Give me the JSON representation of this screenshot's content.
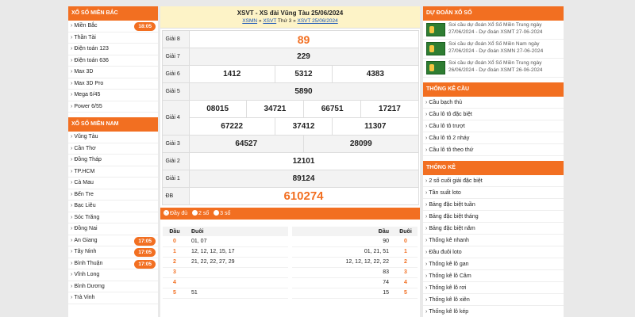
{
  "left": {
    "north_title": "XỔ SỐ MIỀN BẮC",
    "north_items": [
      {
        "label": "Miền Bắc",
        "badge": "18:05"
      },
      {
        "label": "Thần Tài",
        "badge": ""
      },
      {
        "label": "Điện toán 123",
        "badge": ""
      },
      {
        "label": "Điện toán 636",
        "badge": ""
      },
      {
        "label": "Max 3D",
        "badge": ""
      },
      {
        "label": "Max 3D Pro",
        "badge": ""
      },
      {
        "label": "Mega 6/45",
        "badge": ""
      },
      {
        "label": "Power 6/55",
        "badge": ""
      }
    ],
    "south_title": "XỔ SỐ MIỀN NAM",
    "south_items": [
      {
        "label": "Vũng Tàu",
        "badge": ""
      },
      {
        "label": "Cần Thơ",
        "badge": ""
      },
      {
        "label": "Đồng Tháp",
        "badge": ""
      },
      {
        "label": "TP.HCM",
        "badge": ""
      },
      {
        "label": "Cà Mau",
        "badge": ""
      },
      {
        "label": "Bến Tre",
        "badge": ""
      },
      {
        "label": "Bạc Liêu",
        "badge": ""
      },
      {
        "label": "Sóc Trăng",
        "badge": ""
      },
      {
        "label": "Đồng Nai",
        "badge": ""
      },
      {
        "label": "An Giang",
        "badge": "17:05"
      },
      {
        "label": "Tây Ninh",
        "badge": "17:05"
      },
      {
        "label": "Bình Thuận",
        "badge": "17:05"
      },
      {
        "label": "Vĩnh Long",
        "badge": ""
      },
      {
        "label": "Bình Dương",
        "badge": ""
      },
      {
        "label": "Trà Vinh",
        "badge": ""
      }
    ]
  },
  "result": {
    "title": "XSVT - XS đài Vũng Tàu 25/06/2024",
    "crumb1": "XSMN",
    "sep1": "»",
    "crumb2": "XSVT",
    "crumb2_suffix": "Thứ 3",
    "sep2": "»",
    "crumb3": "XSVT 25/06/2024",
    "g8_label": "Giải 8",
    "g8": "89",
    "g7_label": "Giải 7",
    "g7": "229",
    "g6_label": "Giải 6",
    "g6": [
      "1412",
      "5312",
      "4383"
    ],
    "g5_label": "Giải 5",
    "g5": "5890",
    "g4_label": "Giải 4",
    "g4a": [
      "08015",
      "34721",
      "66751",
      "17217"
    ],
    "g4b": [
      "67222",
      "37412",
      "11307"
    ],
    "g3_label": "Giải 3",
    "g3": [
      "64527",
      "28099"
    ],
    "g2_label": "Giải 2",
    "g2": "12101",
    "g1_label": "Giải 1",
    "g1": "89124",
    "db_label": "ĐB",
    "db": "610274"
  },
  "options": {
    "full": "Đầy đủ",
    "two": "2 số",
    "three": "3 số"
  },
  "loto_left": {
    "h_dau": "Đầu",
    "h_duoi": "Đuôi",
    "rows": [
      {
        "dau": "0",
        "duoi": "01, 07"
      },
      {
        "dau": "1",
        "duoi": "12, 12, 12, 15, 17"
      },
      {
        "dau": "2",
        "duoi": "21, 22, 22, 27, 29"
      },
      {
        "dau": "3",
        "duoi": ""
      },
      {
        "dau": "4",
        "duoi": ""
      },
      {
        "dau": "5",
        "duoi": "51"
      }
    ]
  },
  "loto_right": {
    "h_dau": "Đầu",
    "h_duoi": "Đuôi",
    "rows": [
      {
        "dau": "90",
        "duoi": "0"
      },
      {
        "dau": "01, 21, 51",
        "duoi": "1"
      },
      {
        "dau": "12, 12, 12, 22, 22",
        "duoi": "2"
      },
      {
        "dau": "83",
        "duoi": "3"
      },
      {
        "dau": "74",
        "duoi": "4"
      },
      {
        "dau": "15",
        "duoi": "5"
      }
    ]
  },
  "right": {
    "pred_title": "DỰ ĐOÁN XỔ SỐ",
    "preds": [
      {
        "line1": "Soi cầu dự đoán Xổ Số Miền Trung ngày",
        "line2": "27/06/2024 - Dự đoán XSMT 27-06-2024"
      },
      {
        "line1": "Soi cầu dự đoán Xổ Số Miền Nam ngày",
        "line2": "27/06/2024 - Dự đoán XSMN 27-06-2024"
      },
      {
        "line1": "Soi cầu dự đoán Xổ Số Miền Trung ngày",
        "line2": "26/06/2024 - Dự đoán XSMT 26-06-2024"
      }
    ],
    "cau_title": "THỐNG KÊ CẦU",
    "cau_items": [
      "Cầu bạch thủ",
      "Cầu lô tô đặc biệt",
      "Cầu lô tô trượt",
      "Cầu lô tô 2 nháy",
      "Cầu lô tô theo thứ"
    ],
    "tk_title": "THỐNG KÊ",
    "tk_items": [
      "2 số cuối giải đặc biệt",
      "Tần suất loto",
      "Bảng đặc biệt tuần",
      "Bảng đặc biệt tháng",
      "Bảng đặc biệt năm",
      "Thống kê nhanh",
      "Đầu đuôi loto",
      "Thống kê lô gan",
      "Thống kê lô Câm",
      "Thống kê lô rơi",
      "Thống kê lô xiên",
      "Thống kê lô kép"
    ]
  }
}
